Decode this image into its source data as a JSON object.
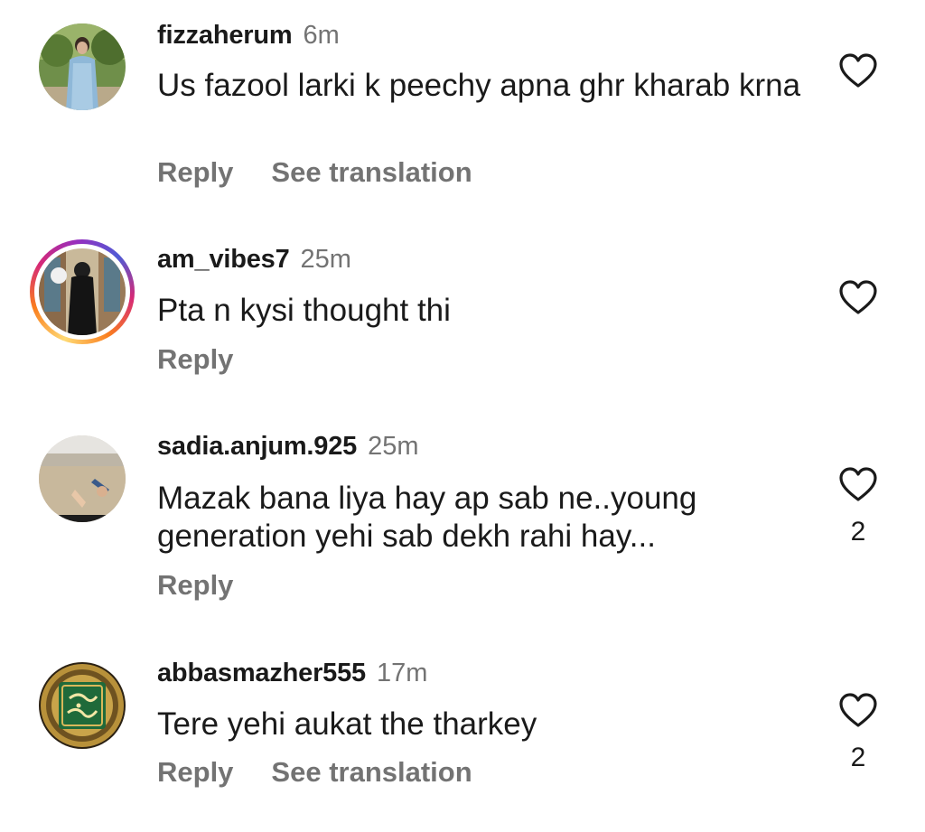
{
  "comments": [
    {
      "username": "fizzaherum",
      "time": "6m",
      "text": "Us fazool larki k peechy apna ghr kharab krna",
      "reply_label": "Reply",
      "translate_label": "See translation",
      "like_icon": "heart-outline-icon",
      "like_count": ""
    },
    {
      "username": "am_vibes7",
      "time": "25m",
      "text": "Pta n kysi thought thi",
      "reply_label": "Reply",
      "translate_label": "",
      "like_icon": "heart-outline-icon",
      "like_count": ""
    },
    {
      "username": "sadia.anjum.925",
      "time": "25m",
      "text": "Mazak bana liya hay ap sab ne..young generation yehi sab dekh rahi hay...",
      "reply_label": "Reply",
      "translate_label": "",
      "like_icon": "heart-outline-icon",
      "like_count": "2"
    },
    {
      "username": "abbasmazher555",
      "time": "17m",
      "text": "Tere yehi aukat the tharkey",
      "reply_label": "Reply",
      "translate_label": "See translation",
      "like_icon": "heart-outline-icon",
      "like_count": "2"
    }
  ],
  "colors": {
    "text": "#1a1a1a",
    "secondary": "#737373",
    "story_ring": [
      "#feda75",
      "#fa7e1e",
      "#d62976",
      "#962fbf",
      "#4f5bd5"
    ]
  }
}
